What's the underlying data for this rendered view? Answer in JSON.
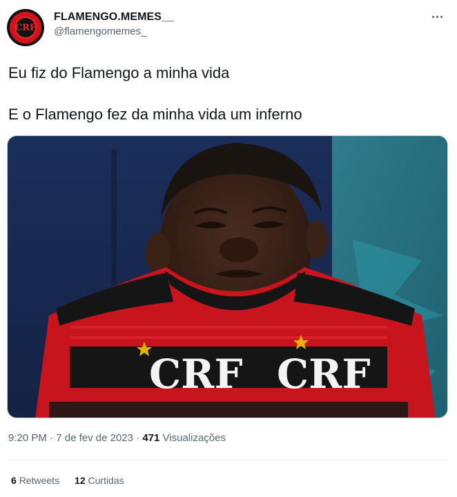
{
  "author": {
    "display_name": "FLAMENGO.MEMES__",
    "handle": "@flamengomemes_",
    "avatar_text": "CRF"
  },
  "menu": {
    "icon": "more-horizontal-icon"
  },
  "tweet": {
    "line1": "Eu fiz do Flamengo a minha vida",
    "line2": "E o Flamengo fez da minha vida um inferno"
  },
  "media": {
    "crest_text": "CRF"
  },
  "meta": {
    "time": "9:20 PM",
    "separator1": "·",
    "date": "7 de fev de 2023",
    "separator2": "·",
    "views_count": "471",
    "views_label": "Visualizações"
  },
  "stats": {
    "retweets_count": "6",
    "retweets_label": "Retweets",
    "likes_count": "12",
    "likes_label": "Curtidas"
  },
  "colors": {
    "text": "#0f1419",
    "secondary": "#536471",
    "flamengo_red": "#d5121b",
    "flamengo_black": "#121212"
  }
}
